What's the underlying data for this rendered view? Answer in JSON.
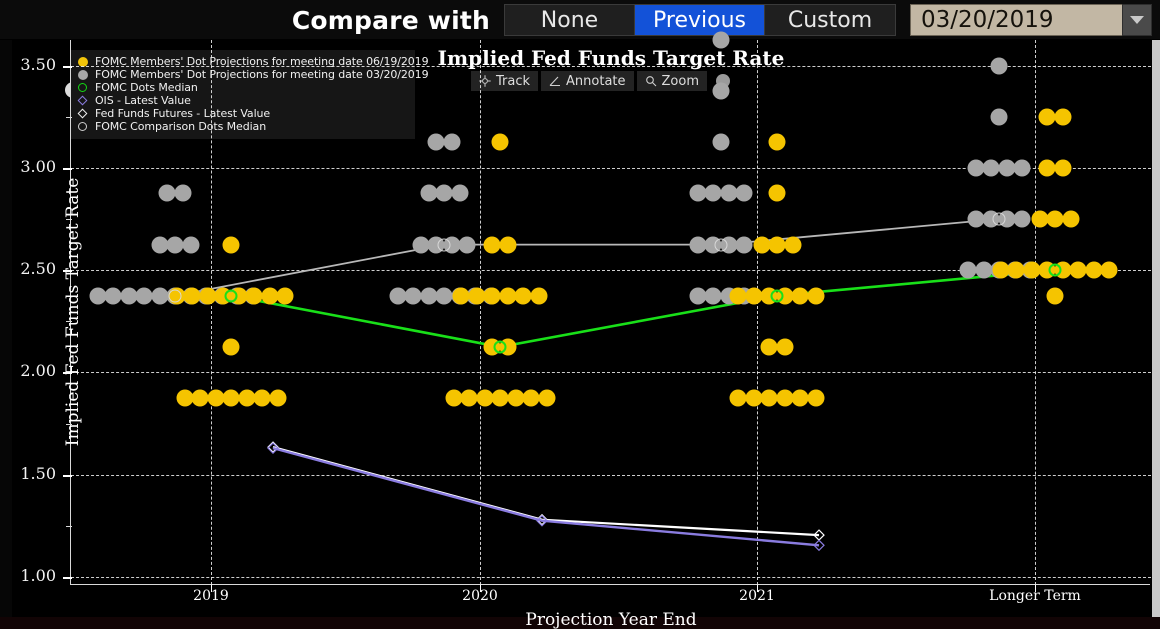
{
  "toolbar": {
    "compare_label": "Compare with",
    "options": [
      {
        "label": "None",
        "active": false
      },
      {
        "label": "Previous",
        "active": true
      },
      {
        "label": "Custom",
        "active": false
      }
    ],
    "date_value": "03/20/2019",
    "dropdown_icon": "chevron-down-icon"
  },
  "chart_tools": [
    {
      "label": "Track",
      "icon": "crosshair-icon"
    },
    {
      "label": "Annotate",
      "icon": "angle-icon"
    },
    {
      "label": "Zoom",
      "icon": "magnifier-icon"
    }
  ],
  "legend": {
    "items": [
      {
        "marker": "filled-circle-yellow",
        "color": "#f2c50a",
        "label": "FOMC Members' Dot Projections for meeting date 06/19/2019"
      },
      {
        "marker": "filled-circle-gray",
        "color": "#a8a8a8",
        "label": "FOMC Members' Dot Projections for meeting date 03/20/2019"
      },
      {
        "marker": "open-circle-green",
        "color": "#13d713",
        "label": "FOMC Dots Median"
      },
      {
        "marker": "open-diamond-purple",
        "color": "#8a7ce0",
        "label": "OIS - Latest Value"
      },
      {
        "marker": "open-diamond-white",
        "color": "#f0f0f0",
        "label": "Fed Funds Futures - Latest Value"
      },
      {
        "marker": "open-circle-white",
        "color": "#cccccc",
        "label": "FOMC Comparison Dots Median"
      }
    ]
  },
  "chart_data": {
    "type": "scatter",
    "title": "Implied Fed Funds Target Rate",
    "xlabel": "Projection Year End",
    "ylabel": "Implied Fed Funds Target Rate",
    "ylim": [
      1.0,
      3.625
    ],
    "yticks": [
      1.0,
      1.5,
      2.0,
      2.5,
      3.0,
      3.5
    ],
    "ytick_labels": [
      "1.00",
      "1.50",
      "2.00",
      "2.50",
      "3.00",
      "3.50"
    ],
    "yminor_step": 0.25,
    "categories": [
      "2019",
      "2020",
      "2021",
      "Longer Term"
    ],
    "grid": true,
    "legend_position": "top-left",
    "series": [
      {
        "name": "FOMC Members' Dot Projections for meeting date 03/20/2019",
        "marker": "filled-circle-gray",
        "color": "#a6a6a6",
        "offset": -0.18,
        "clusters": [
          {
            "category": "2019",
            "points": [
              {
                "value": 2.875,
                "count": 2
              },
              {
                "value": 2.625,
                "count": 3
              },
              {
                "value": 2.375,
                "count": 11
              }
            ]
          },
          {
            "category": "2020",
            "points": [
              {
                "value": 3.125,
                "count": 2
              },
              {
                "value": 2.875,
                "count": 3
              },
              {
                "value": 2.625,
                "count": 4
              },
              {
                "value": 2.375,
                "count": 7
              }
            ]
          },
          {
            "category": "2021",
            "points": [
              {
                "value": 3.625,
                "count": 1
              },
              {
                "value": 3.375,
                "count": 1
              },
              {
                "value": 3.125,
                "count": 1
              },
              {
                "value": 2.875,
                "count": 4
              },
              {
                "value": 2.625,
                "count": 4
              },
              {
                "value": 2.375,
                "count": 4
              }
            ]
          },
          {
            "category": "Longer Term",
            "points": [
              {
                "value": 3.5,
                "count": 1
              },
              {
                "value": 3.25,
                "count": 1
              },
              {
                "value": 3.0,
                "count": 4
              },
              {
                "value": 2.75,
                "count": 4
              },
              {
                "value": 2.5,
                "count": 5
              }
            ]
          }
        ]
      },
      {
        "name": "FOMC Members' Dot Projections for meeting date 06/19/2019",
        "marker": "filled-circle-yellow",
        "color": "#f5c400",
        "offset": 0.1,
        "clusters": [
          {
            "category": "2019",
            "points": [
              {
                "value": 2.625,
                "count": 1
              },
              {
                "value": 2.375,
                "count": 8
              },
              {
                "value": 2.125,
                "count": 1
              },
              {
                "value": 1.875,
                "count": 7
              }
            ]
          },
          {
            "category": "2020",
            "points": [
              {
                "value": 3.125,
                "count": 1
              },
              {
                "value": 2.625,
                "count": 2
              },
              {
                "value": 2.375,
                "count": 6
              },
              {
                "value": 2.125,
                "count": 2
              },
              {
                "value": 1.875,
                "count": 7
              }
            ]
          },
          {
            "category": "2021",
            "points": [
              {
                "value": 3.125,
                "count": 1
              },
              {
                "value": 2.875,
                "count": 1
              },
              {
                "value": 2.625,
                "count": 3
              },
              {
                "value": 2.375,
                "count": 6
              },
              {
                "value": 2.125,
                "count": 2
              },
              {
                "value": 1.875,
                "count": 6
              }
            ]
          },
          {
            "category": "Longer Term",
            "points": [
              {
                "value": 3.25,
                "count": 2
              },
              {
                "value": 3.0,
                "count": 2
              },
              {
                "value": 2.75,
                "count": 3
              },
              {
                "value": 2.5,
                "count": 8
              },
              {
                "value": 2.375,
                "count": 1
              }
            ]
          }
        ]
      },
      {
        "name": "FOMC Dots Median",
        "marker": "open-circle-green",
        "color": "#19e019",
        "line": true,
        "values": [
          {
            "category": "2019",
            "value": 2.375
          },
          {
            "category": "2020",
            "value": 2.125
          },
          {
            "category": "2021",
            "value": 2.375
          },
          {
            "category": "Longer Term",
            "value": 2.5
          }
        ]
      },
      {
        "name": "FOMC Comparison Dots Median",
        "marker": "open-circle-white",
        "color": "#b8b8b8",
        "line": true,
        "values": [
          {
            "category": "2019",
            "value": 2.375
          },
          {
            "category": "2020",
            "value": 2.625
          },
          {
            "category": "2021",
            "value": 2.625
          },
          {
            "category": "Longer Term",
            "value": 2.75
          }
        ]
      },
      {
        "name": "Fed Funds Futures - Latest Value",
        "marker": "open-diamond-white",
        "color": "#ffffff",
        "line": true,
        "values": [
          {
            "category": "2019",
            "value": 1.635
          },
          {
            "category": "2020",
            "value": 1.28
          },
          {
            "category": "2021",
            "value": 1.205
          }
        ]
      },
      {
        "name": "OIS - Latest Value",
        "marker": "open-diamond-purple",
        "color": "#8a7ce0",
        "line": true,
        "values": [
          {
            "category": "2019",
            "value": 1.63
          },
          {
            "category": "2020",
            "value": 1.275
          },
          {
            "category": "2021",
            "value": 1.155
          }
        ]
      }
    ]
  }
}
